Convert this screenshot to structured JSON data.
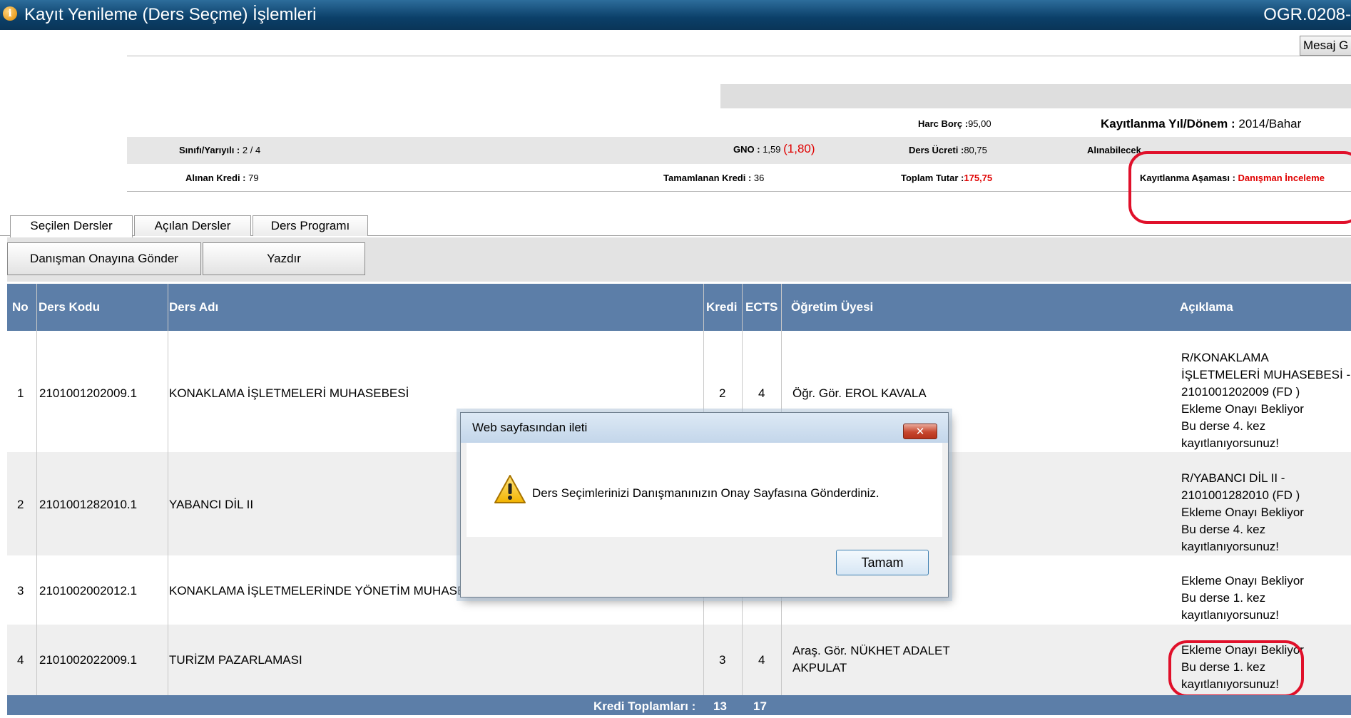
{
  "window": {
    "title": "Kayıt Yenileme (Ders Seçme) İşlemleri",
    "code": "OGR.0208-",
    "mesaj_button": "Mesaj G"
  },
  "info": {
    "harc_label": "Harc Borç :",
    "harc_value": "95,00",
    "year_label": "Kayıtlanma Yıl/Dönem :",
    "year_value": "2014/Bahar",
    "sinif_label": "Sınıfı/Yarıyılı :",
    "sinif_value": "2 / 4",
    "gno_label": "GNO :",
    "gno_value": "1,59",
    "gno_extra": "(1,80)",
    "ucret_label": "Ders Ücreti :",
    "ucret_value": "80,75",
    "alinabilecek_label": "Alınabilecek",
    "alinan_label": "Alınan Kredi :",
    "alinan_value": "79",
    "tamamlanan_label": "Tamamlanan Kredi :",
    "tamamlanan_value": "36",
    "toplam_label": "Toplam Tutar :",
    "toplam_value": "175,75",
    "asama_label": "Kayıtlanma Aşaması :",
    "asama_value": "Danışman İnceleme"
  },
  "tabs": [
    "Seçilen Dersler",
    "Açılan Dersler",
    "Ders Programı"
  ],
  "buttons": {
    "send": "Danışman Onayına Gönder",
    "print": "Yazdır"
  },
  "table": {
    "headers": {
      "no": "No",
      "code": "Ders Kodu",
      "name": "Ders Adı",
      "kredi": "Kredi",
      "ects": "ECTS",
      "teacher": "Öğretim Üyesi",
      "desc": "Açıklama"
    },
    "rows": [
      {
        "no": "1",
        "code": "2101001202009.1",
        "name": "KONAKLAMA İŞLETMELERİ MUHASEBESİ",
        "kredi": "2",
        "ects": "4",
        "teacher": "Öğr. Gör. EROL KAVALA",
        "teacher2": "",
        "desc": [
          "R/KONAKLAMA",
          "İŞLETMELERİ MUHASEBESİ -",
          "2101001202009 (FD )",
          "Ekleme Onayı Bekliyor",
          "Bu derse 4. kez",
          "kayıtlanıyorsunuz!"
        ]
      },
      {
        "no": "2",
        "code": "2101001282010.1",
        "name": "YABANCI DİL II",
        "kredi": "",
        "ects": "",
        "teacher": "",
        "teacher2": "",
        "desc": [
          "R/YABANCI DİL II -",
          "2101001282010 (FD )",
          "Ekleme Onayı Bekliyor",
          "Bu derse 4. kez",
          "kayıtlanıyorsunuz!"
        ]
      },
      {
        "no": "3",
        "code": "2101002002012.1",
        "name": "KONAKLAMA İŞLETMELERİNDE YÖNETİM MUHASE",
        "kredi": "",
        "ects": "",
        "teacher": "",
        "teacher2": "",
        "desc": [
          "Ekleme Onayı Bekliyor",
          "Bu derse 1. kez",
          "kayıtlanıyorsunuz!"
        ]
      },
      {
        "no": "4",
        "code": "2101002022009.1",
        "name": "TURİZM PAZARLAMASI",
        "kredi": "3",
        "ects": "4",
        "teacher": "Araş. Gör. NÜKHET ADALET",
        "teacher2": "AKPULAT",
        "desc": [
          "Ekleme Onayı Bekliyor",
          "Bu derse 1. kez",
          "kayıtlanıyorsunuz!"
        ]
      }
    ],
    "footer": {
      "label": "Kredi Toplamları :",
      "kredi_total": "13",
      "ects_total": "17"
    }
  },
  "dialog": {
    "title": "Web sayfasından ileti",
    "message": "Ders Seçimlerinizi Danışmanınızın Onay Sayfasına Gönderdiniz.",
    "ok": "Tamam",
    "close_glyph": "✕"
  },
  "colors": {
    "header_blue": "#5c7ea8",
    "title_blue": "#0b3f68",
    "highlight_red": "#e0102a"
  }
}
